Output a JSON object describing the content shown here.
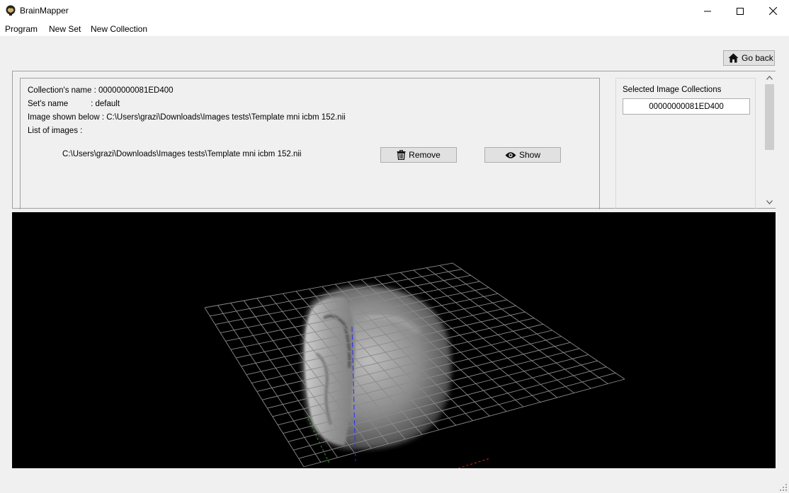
{
  "window": {
    "title": "BrainMapper",
    "icons": {
      "app": "brain-app-icon",
      "minimize": "minimize-icon",
      "maximize": "maximize-icon",
      "close": "close-icon"
    }
  },
  "menu": [
    "Program",
    "New Set",
    "New Collection"
  ],
  "toolbar": {
    "go_back_label": "Go back",
    "go_back_icon": "home-icon"
  },
  "info": {
    "collection_line": "Collection's name : 00000000081ED400",
    "set_line": "Set's name          : default",
    "image_line": "Image shown below : C:\\Users\\grazi\\Downloads\\Images tests\\Template mni icbm 152.nii",
    "list_label": "List of images :"
  },
  "images": [
    {
      "path": "C:\\Users\\grazi\\Downloads\\Images tests\\Template mni icbm 152.nii",
      "remove_label": "Remove",
      "show_label": "Show"
    }
  ],
  "collections": {
    "label": "Selected Image Collections",
    "items": [
      "00000000081ED400"
    ]
  },
  "viewer": {
    "background": "#000000",
    "grid_color": "#8a8a8a",
    "axis_colors": {
      "x": "#cc2a1a",
      "y": "#2aa02a",
      "z": "#2a2aff"
    }
  }
}
